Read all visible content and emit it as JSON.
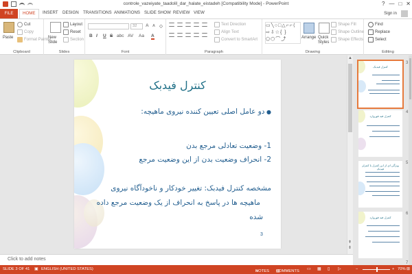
{
  "window": {
    "title": "controle_vazeiyate_taadolil_dar_halate_eistadeh [Compatibility Mode] - PowerPoint",
    "help": "?",
    "min": "—",
    "max": "□",
    "close": "✕"
  },
  "tabs": [
    {
      "label": "FILE"
    },
    {
      "label": "HOME"
    },
    {
      "label": "INSERT"
    },
    {
      "label": "DESIGN"
    },
    {
      "label": "TRANSITIONS"
    },
    {
      "label": "ANIMATIONS"
    },
    {
      "label": "SLIDE SHOW"
    },
    {
      "label": "REVIEW"
    },
    {
      "label": "VIEW"
    }
  ],
  "signin": "Sign in",
  "ribbon": {
    "clipboard": {
      "label": "Clipboard",
      "paste": "Paste",
      "cut": "Cut",
      "copy": "Copy",
      "format_painter": "Format Painter"
    },
    "slides": {
      "label": "Slides",
      "new_slide": "New Slide",
      "layout": "Layout",
      "reset": "Reset",
      "section": "Section"
    },
    "font": {
      "label": "Font",
      "size": "32",
      "bold": "B",
      "italic": "I",
      "underline": "U",
      "strike": "S",
      "shadow": "abc",
      "spacing": "AV",
      "case": "Aa",
      "color": "A"
    },
    "paragraph": {
      "label": "Paragraph",
      "text_direction": "Text Direction",
      "align_text": "Align Text",
      "smartart": "Convert to SmartArt"
    },
    "drawing": {
      "label": "Drawing",
      "arrange": "Arrange",
      "quick_styles": "Quick Styles",
      "shape_fill": "Shape Fill",
      "shape_outline": "Shape Outline",
      "shape_effects": "Shape Effects"
    },
    "editing": {
      "label": "Editing",
      "find": "Find",
      "replace": "Replace",
      "select": "Select"
    }
  },
  "slide": {
    "title": "کنترل فیدبک",
    "bullet": "دو عامل اصلی تعیین کننده نیروی ماهیچه:",
    "item1": "1- وضعیت تعادلی مرجع بدن",
    "item2": "2- انحراف وضعیت بدن از این وضعیت مرجع",
    "para_line1": "مشخصه کنترل فیدبک: تغییر خودکار و ناخودآگاه نیروی",
    "para_line2": "ماهیچه ها در پاسخ به انحراف از یک وضعیت مرجع داده",
    "para_line3": "شده",
    "number": "3"
  },
  "thumbnails": [
    {
      "num": "3",
      "title": "کنترل فیدبک",
      "selected": true
    },
    {
      "num": "4",
      "title": "کنترل فید فوروارد",
      "selected": false
    },
    {
      "num": "5",
      "title": "ویژگی ای از این کنترل با کنترلر فیدبک",
      "selected": false
    },
    {
      "num": "6",
      "title": "کنترل فید فوروارد",
      "selected": false
    }
  ],
  "notes_placeholder": "Click to add notes",
  "status": {
    "slide": "SLIDE 3 OF 41",
    "language": "ENGLISH (UNITED STATES)",
    "notes": "NOTES",
    "comments": "COMMENTS",
    "zoom": "70%",
    "minus": "−",
    "plus": "+"
  },
  "colors": {
    "accent": "#d04423",
    "slide_text": "#225e8f",
    "selected_thumb": "#e6793b"
  }
}
